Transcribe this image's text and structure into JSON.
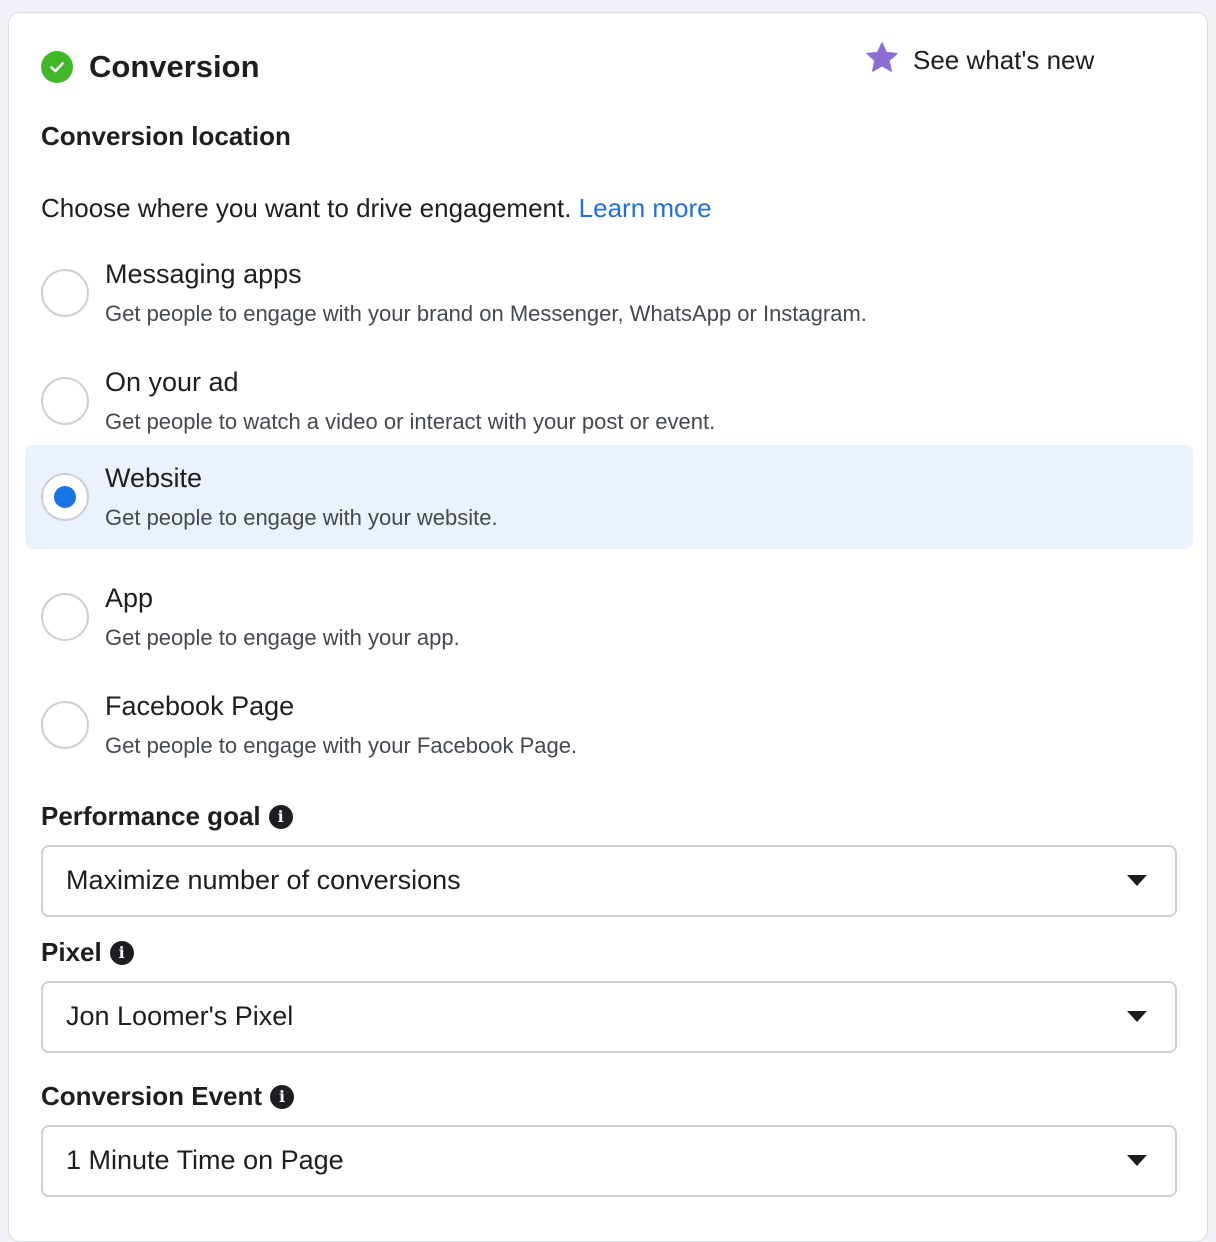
{
  "header": {
    "title": "Conversion",
    "whats_new_label": "See what's new"
  },
  "conversion_location": {
    "title": "Conversion location",
    "description": "Choose where you want to drive engagement.",
    "learn_more": "Learn more",
    "selected": "Website",
    "options": [
      {
        "label": "Messaging apps",
        "description": "Get people to engage with your brand on Messenger, WhatsApp or Instagram."
      },
      {
        "label": "On your ad",
        "description": "Get people to watch a video or interact with your post or event."
      },
      {
        "label": "Website",
        "description": "Get people to engage with your website."
      },
      {
        "label": "App",
        "description": "Get people to engage with your app."
      },
      {
        "label": "Facebook Page",
        "description": "Get people to engage with your Facebook Page."
      }
    ]
  },
  "performance_goal": {
    "label": "Performance goal",
    "value": "Maximize number of conversions"
  },
  "pixel": {
    "label": "Pixel",
    "value": "Jon Loomer's Pixel"
  },
  "conversion_event": {
    "label": "Conversion Event",
    "value": "1 Minute Time on Page"
  },
  "colors": {
    "accent": "#1b74e4",
    "link": "#216fdb",
    "success": "#42b72a",
    "star": "#8b6fd1",
    "selected_bg": "#ebf2fd"
  },
  "icons": {
    "header_status": "check-circle-icon",
    "whats_new": "star-icon",
    "info": "info-icon",
    "dropdown": "caret-down-icon"
  }
}
